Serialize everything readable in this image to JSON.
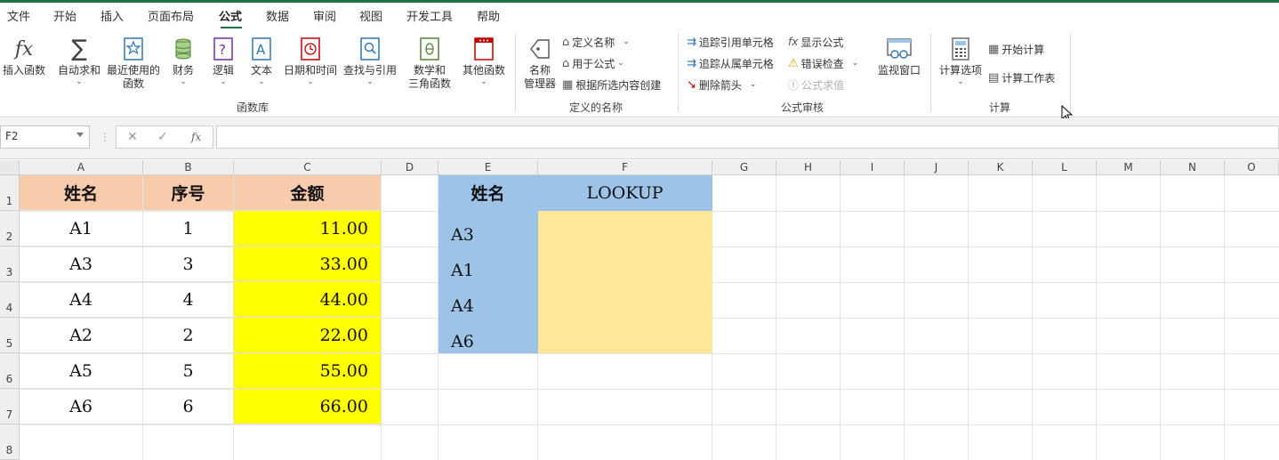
{
  "menu": {
    "tabs": [
      "文件",
      "开始",
      "插入",
      "页面布局",
      "公式",
      "数据",
      "审阅",
      "视图",
      "开发工具",
      "帮助"
    ]
  },
  "ribbon": {
    "function_library": {
      "insert_function": "插入函数",
      "autosum": "自动求和",
      "recent_1": "最近使用的",
      "recent_2": "函数",
      "financial": "财务",
      "logical": "逻辑",
      "text": "文本",
      "datetime": "日期和时间",
      "lookup": "查找与引用",
      "math_1": "数学和",
      "math_2": "三角函数",
      "more": "其他函数",
      "group_label": "函数库"
    },
    "defined_names": {
      "manager_1": "名称",
      "manager_2": "管理器",
      "define_name": "定义名称",
      "use_in_formula": "用于公式",
      "create_from_selection": "根据所选内容创建",
      "group_label": "定义的名称"
    },
    "formula_auditing": {
      "trace_precedents": "追踪引用单元格",
      "trace_dependents": "追踪从属单元格",
      "remove_arrows": "删除箭头",
      "show_formulas": "显示公式",
      "error_checking": "错误检查",
      "evaluate_formula": "公式求值",
      "watch_window": "监视窗口",
      "group_label": "公式审核"
    },
    "calculation": {
      "options": "计算选项",
      "calc_now": "开始计算",
      "calc_sheet": "计算工作表",
      "group_label": "计算"
    }
  },
  "formula_bar": {
    "name_box": "F2",
    "formula": ""
  },
  "columns": [
    "A",
    "B",
    "C",
    "D",
    "E",
    "F",
    "G",
    "H",
    "I",
    "J",
    "K",
    "L",
    "M",
    "N",
    "O"
  ],
  "rows": [
    "1",
    "2",
    "3",
    "4",
    "5",
    "6",
    "7",
    "8"
  ],
  "table1": {
    "headers": [
      "姓名",
      "序号",
      "金额"
    ],
    "rows": [
      [
        "A1",
        "1",
        "11.00"
      ],
      [
        "A3",
        "3",
        "33.00"
      ],
      [
        "A4",
        "4",
        "44.00"
      ],
      [
        "A2",
        "2",
        "22.00"
      ],
      [
        "A5",
        "5",
        "55.00"
      ],
      [
        "A6",
        "6",
        "66.00"
      ]
    ]
  },
  "table2": {
    "headers": [
      "姓名",
      "LOOKUP"
    ],
    "names": [
      "A3",
      "A1",
      "A4",
      "A6"
    ]
  },
  "colors": {
    "header_fill_1": "#f8cbad",
    "amount_fill": "#ffff00",
    "header_fill_2": "#9dc3e6",
    "lookup_fill": "#ffe699",
    "accent": "#1e7145"
  }
}
